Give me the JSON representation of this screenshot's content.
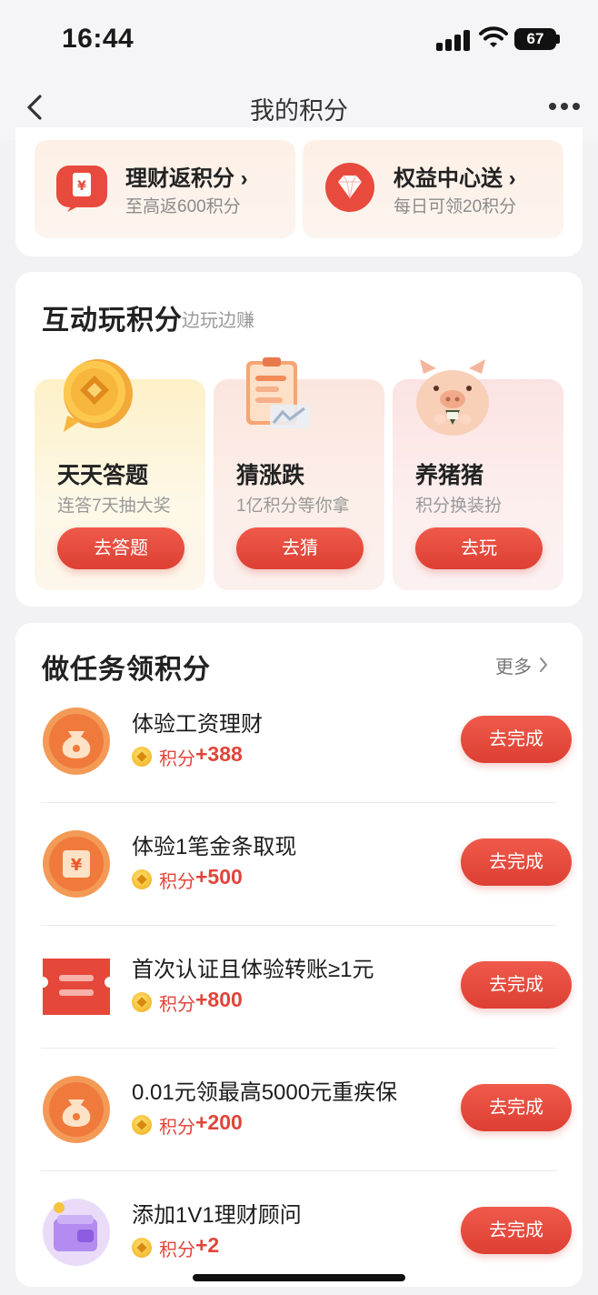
{
  "status_bar": {
    "time": "16:44",
    "battery": "67"
  },
  "nav": {
    "title": "我的积分"
  },
  "promos": [
    {
      "title": "理财返积分",
      "chevron": "›",
      "subtitle": "至高返600积分",
      "icon": "wallet-yen-icon"
    },
    {
      "title": "权益中心送",
      "chevron": "›",
      "subtitle": "每日可领20积分",
      "icon": "diamond-icon"
    }
  ],
  "play_section": {
    "title": "互动玩积分",
    "subtitle": "边玩边赚",
    "games": [
      {
        "title": "天天答题",
        "subtitle": "连答7天抽大奖",
        "button": "去答题",
        "icon": "gold-coin-chat-icon"
      },
      {
        "title": "猜涨跌",
        "subtitle": "1亿积分等你拿",
        "button": "去猜",
        "icon": "clipboard-chart-icon"
      },
      {
        "title": "养猪猪",
        "subtitle": "积分换装扮",
        "button": "去玩",
        "icon": "pig-icon"
      }
    ]
  },
  "task_section": {
    "title": "做任务领积分",
    "more": "更多",
    "points_label": "积分",
    "tasks": [
      {
        "title": "体验工资理财",
        "points": "+388",
        "button": "去完成",
        "icon": "money-bag-icon"
      },
      {
        "title": "体验1笔金条取现",
        "points": "+500",
        "button": "去完成",
        "icon": "yen-card-icon"
      },
      {
        "title": "首次认证且体验转账≥1元",
        "points": "+800",
        "button": "去完成",
        "icon": "ticket-icon"
      },
      {
        "title": "0.01元领最高5000元重疾保",
        "points": "+200",
        "button": "去完成",
        "icon": "money-bag-icon"
      },
      {
        "title": "添加1V1理财顾问",
        "points": "+2",
        "button": "去完成",
        "icon": "purple-wallet-icon"
      }
    ]
  },
  "colors": {
    "accent": "#e0453a",
    "button": "#dd3f33"
  }
}
